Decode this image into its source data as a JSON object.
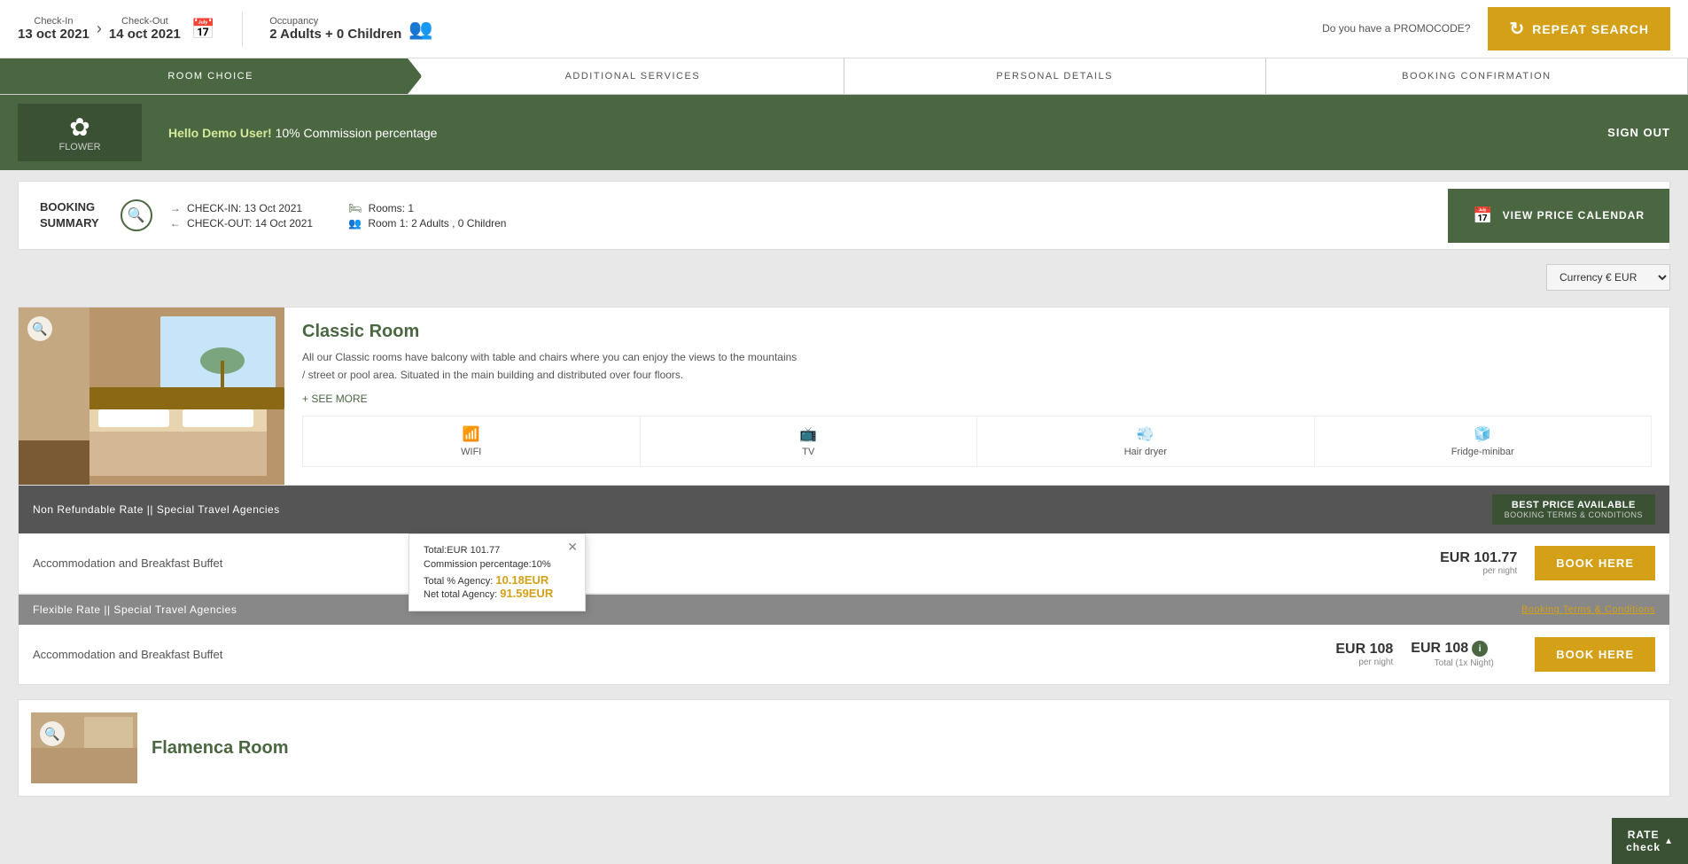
{
  "topbar": {
    "checkin_label": "Check-In",
    "checkin_value": "13 oct 2021",
    "checkout_label": "Check-Out",
    "checkout_value": "14 oct 2021",
    "occupancy_label": "Occupancy",
    "occupancy_value": "2 Adults + 0 Children",
    "promo_label": "Do you have a PROMOCODE?",
    "repeat_search": "REPEAT SEARCH"
  },
  "progress": {
    "steps": [
      "ROOM CHOICE",
      "ADDITIONAL SERVICES",
      "PERSONAL DETAILS",
      "BOOKING CONFIRMATION"
    ]
  },
  "hotel": {
    "logo_text": "FLOWER",
    "greeting": "Hello Demo User!",
    "commission": "10% Commission percentage",
    "sign_out": "SIGN OUT"
  },
  "booking_summary": {
    "label": "BOOKING\nSUMMARY",
    "checkin": "CHECK-IN: 13 Oct 2021",
    "checkout": "CHECK-OUT: 14 Oct 2021",
    "rooms": "Rooms: 1",
    "room_detail": "Room 1: 2 Adults , 0 Children",
    "view_calendar": "VIEW PRICE CALENDAR"
  },
  "currency": {
    "label": "Currency",
    "value": "€ EUR"
  },
  "classic_room": {
    "name": "Classic Room",
    "description": "All our Classic rooms have balcony with table and chairs where you can enjoy the views to the mountains / street or pool area. Situated in the main building and distributed over four floors.",
    "see_more": "+ SEE MORE",
    "amenities": [
      {
        "icon": "wifi",
        "label": "WIFI"
      },
      {
        "icon": "tv",
        "label": "TV"
      },
      {
        "icon": "hair",
        "label": "Hair dryer"
      },
      {
        "icon": "fridge",
        "label": "Fridge-minibar"
      }
    ],
    "rate1": {
      "header": "Non Refundable Rate || Special Travel Agencies",
      "best_price_line1": "BEST PRICE AVAILABLE",
      "best_price_line2": "BOOKING TERMS & CONDITIONS",
      "row_name": "Accommodation and Breakfast Buffet",
      "price": "EUR 101.77",
      "per_night": "per night",
      "book_btn": "BOOK HERE",
      "tooltip": {
        "total": "Total:EUR 101.77",
        "commission_label": "Commission percentage:10%",
        "agency_total_label": "Total % Agency:",
        "agency_total_value": "10.18EUR",
        "net_total_label": "Net total Agency:",
        "net_total_value": "91.59EUR"
      }
    },
    "rate2": {
      "header": "Flexible Rate || Special Travel Agencies",
      "terms_link": "Booking Terms & Conditions",
      "row_name": "Accommodation and Breakfast Buffet",
      "price": "EUR 108",
      "per_night": "per night",
      "total": "EUR 108",
      "total_night": "Total (1x Night)",
      "book_btn": "BOOK HERE"
    }
  },
  "flamenca_room": {
    "name": "Flamenca Room"
  },
  "rate_check": {
    "label": "RATE\ncheck"
  }
}
